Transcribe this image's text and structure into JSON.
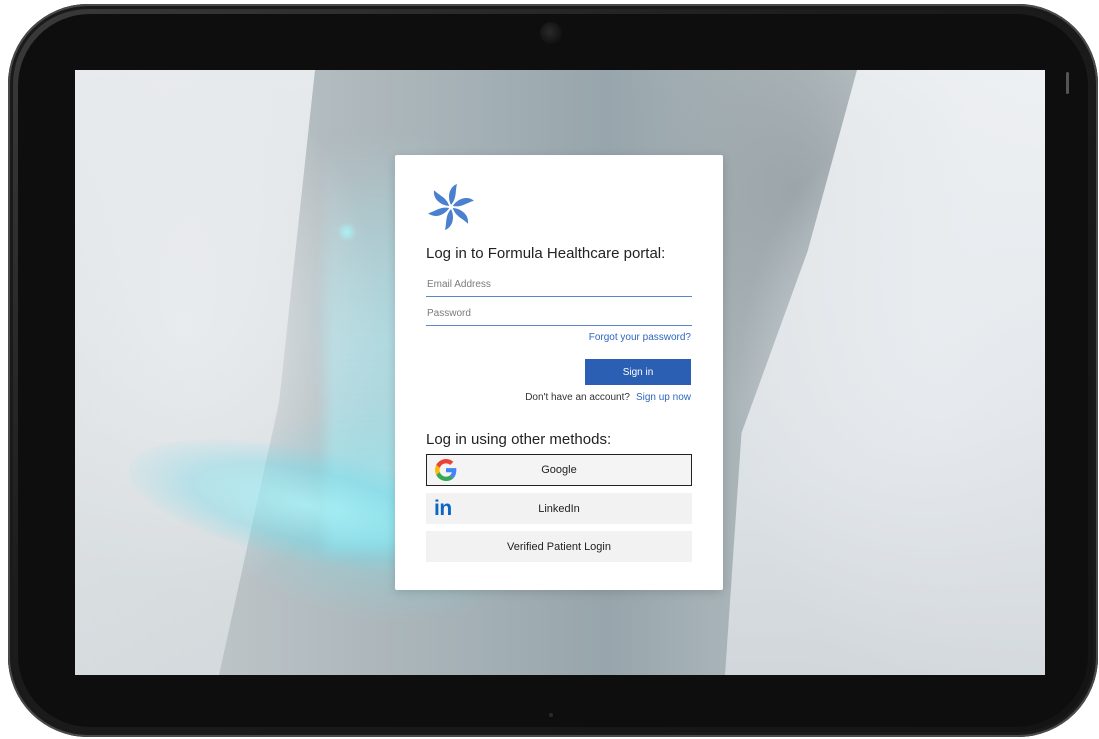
{
  "login": {
    "title": "Log in to Formula Healthcare portal:",
    "email_placeholder": "Email Address",
    "password_placeholder": "Password",
    "forgot_password": "Forgot your password?",
    "sign_in": "Sign in",
    "no_account": "Don't have an account?",
    "sign_up": "Sign up now"
  },
  "other_methods": {
    "title": "Log in using other methods:",
    "google": "Google",
    "linkedin": "LinkedIn",
    "verified_patient": "Verified Patient Login"
  },
  "icons": {
    "logo": "pinwheel-logo",
    "google": "google-icon",
    "linkedin": "linkedin-icon"
  },
  "colors": {
    "primary": "#2b5fb4",
    "link": "#2f66c0",
    "logo": "#4a80cf",
    "linkedin": "#0a66c2"
  }
}
